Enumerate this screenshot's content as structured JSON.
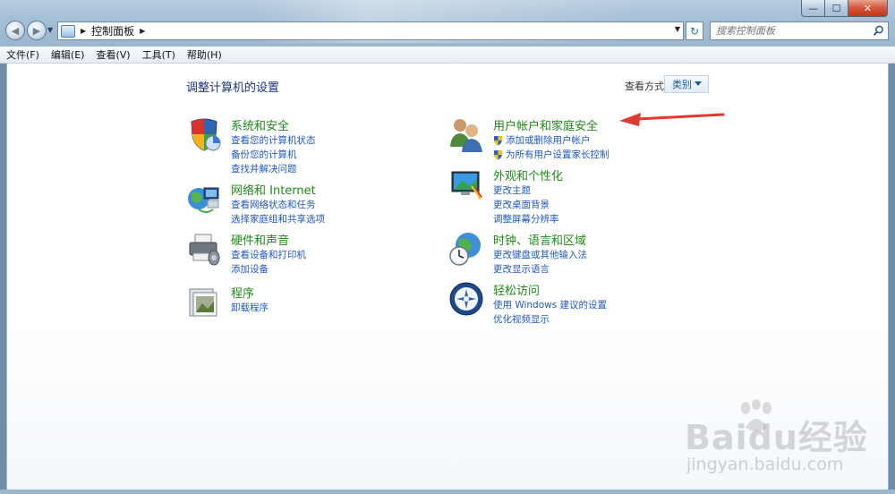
{
  "window": {
    "caption_min": "—",
    "caption_max": "☐",
    "caption_close": "✕"
  },
  "nav": {
    "back_glyph": "◀",
    "forward_glyph": "▶",
    "address_text": "控制面板",
    "search_placeholder": "搜索控制面板"
  },
  "menu": [
    "文件(F)",
    "编辑(E)",
    "查看(V)",
    "工具(T)",
    "帮助(H)"
  ],
  "content": {
    "title": "调整计算机的设置",
    "view_by_label": "查看方式:",
    "view_by_value": "类别"
  },
  "categories_left": [
    {
      "title": "系统和安全",
      "icon": "shield-icon",
      "links": [
        "查看您的计算机状态",
        "备份您的计算机",
        "查找并解决问题"
      ]
    },
    {
      "title": "网络和 Internet",
      "icon": "network-icon",
      "links": [
        "查看网络状态和任务",
        "选择家庭组和共享选项"
      ]
    },
    {
      "title": "硬件和声音",
      "icon": "printer-icon",
      "links": [
        "查看设备和打印机",
        "添加设备"
      ]
    },
    {
      "title": "程序",
      "icon": "programs-icon",
      "links": [
        "卸载程序"
      ]
    }
  ],
  "categories_right": [
    {
      "title": "用户帐户和家庭安全",
      "icon": "users-icon",
      "links": [
        "添加或删除用户帐户",
        "为所有用户设置家长控制"
      ]
    },
    {
      "title": "外观和个性化",
      "icon": "appearance-icon",
      "links": [
        "更改主题",
        "更改桌面背景",
        "调整屏幕分辨率"
      ]
    },
    {
      "title": "时钟、语言和区域",
      "icon": "clock-globe-icon",
      "links": [
        "更改键盘或其他输入法",
        "更改显示语言"
      ]
    },
    {
      "title": "轻松访问",
      "icon": "ease-of-access-icon",
      "links": [
        "使用 Windows 建议的设置",
        "优化视频显示"
      ]
    }
  ],
  "watermark": {
    "brand": "Baidu经验",
    "url": "jingyan.baidu.com"
  }
}
